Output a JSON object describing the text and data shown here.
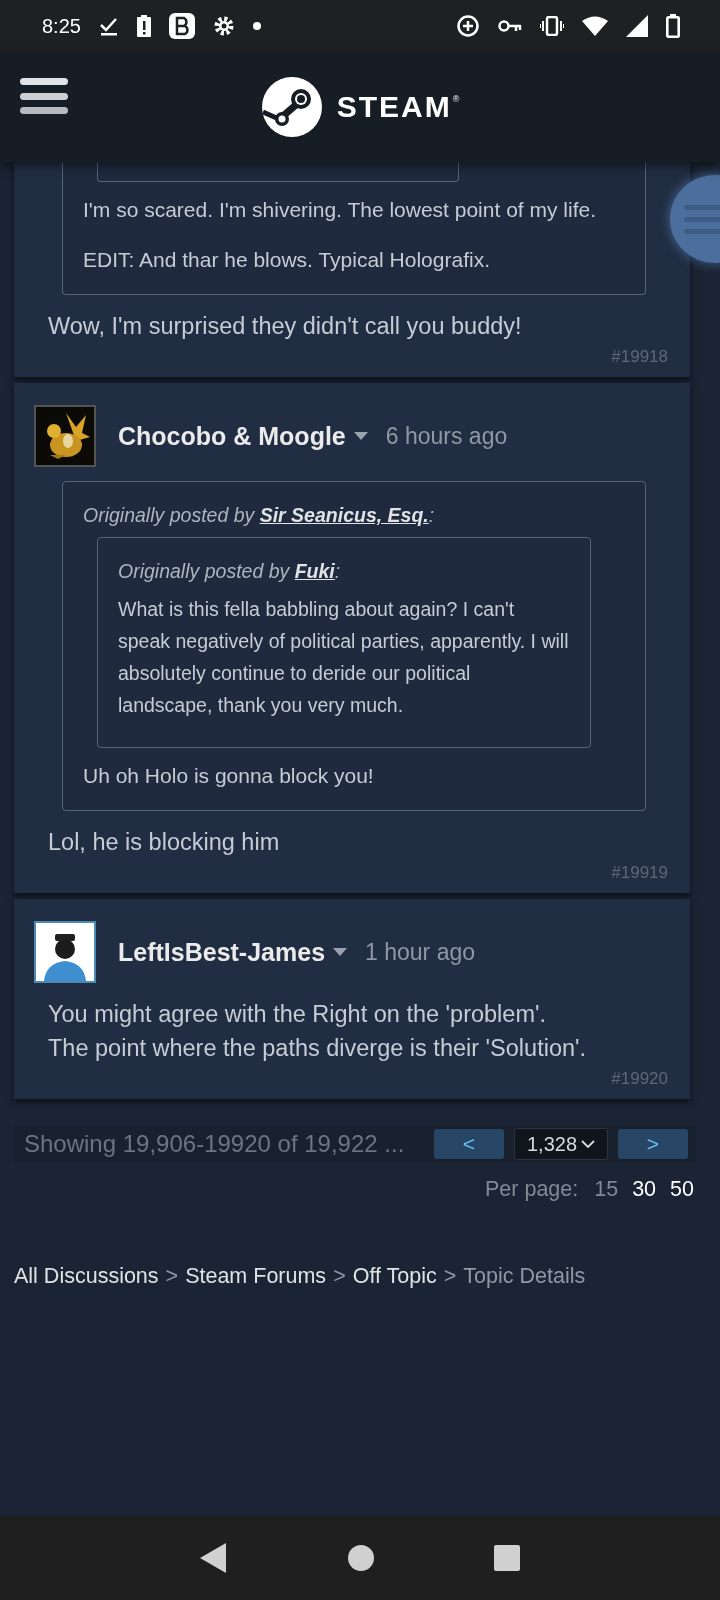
{
  "status_bar": {
    "time": "8:25"
  },
  "header": {
    "logo_text": "STEAM",
    "registered_mark": "®"
  },
  "posts": [
    {
      "quote": {
        "truncated": true,
        "quote": {
          "truncated": true
        },
        "paragraphs": [
          "I'm so scared. I'm shivering. The lowest point of my life.",
          "EDIT: And thar he blows. Typical Holografix."
        ]
      },
      "body": [
        "Wow, I'm surprised they didn't call you buddy!"
      ],
      "number": "#19918"
    },
    {
      "author": "Chocobo & Moogle",
      "time": "6 hours ago",
      "quote": {
        "truncated": false,
        "prefix": "Originally posted by",
        "author": "Sir Seanicus, Esq.",
        "suffix": ":",
        "quote": {
          "truncated": false,
          "prefix": "Originally posted by",
          "author": "Fuki",
          "suffix": ":",
          "paragraphs": [
            "What is this fella babbling about again? I can't speak negatively of political parties, apparently. I will absolutely continue to deride our political landscape, thank you very much."
          ]
        },
        "paragraphs": [
          "Uh oh Holo is gonna block you!"
        ]
      },
      "body": [
        "Lol, he is blocking him"
      ],
      "number": "#19919"
    },
    {
      "author": "LeftIsBest-James",
      "time": "1 hour ago",
      "body": [
        "You might agree with the Right on the 'problem'.",
        "The point where the paths diverge is their 'Solution'."
      ],
      "number": "#19920"
    }
  ],
  "pagination": {
    "summary": "Showing 19,906-19920 of 19,922 ...",
    "prev": "<",
    "page": "1,328",
    "next": ">",
    "per_page_label": "Per page:",
    "per_page": [
      {
        "label": "15",
        "selected": true
      },
      {
        "label": "30",
        "selected": false
      },
      {
        "label": "50",
        "selected": false
      }
    ]
  },
  "breadcrumbs": [
    {
      "kind": "link",
      "label": "All Discussions"
    },
    {
      "kind": "separator",
      "label": ">"
    },
    {
      "kind": "link",
      "label": "Steam Forums"
    },
    {
      "kind": "separator",
      "label": ">"
    },
    {
      "kind": "link",
      "label": "Off Topic"
    },
    {
      "kind": "separator",
      "label": ">"
    },
    {
      "kind": "current",
      "label": "Topic Details"
    }
  ]
}
